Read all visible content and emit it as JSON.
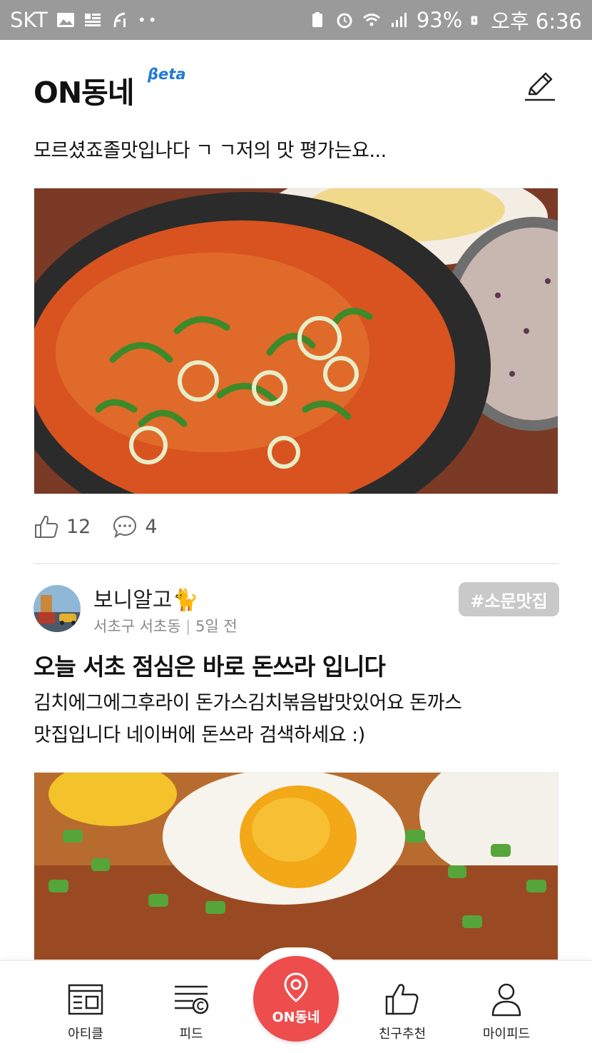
{
  "status_bar": {
    "carrier": "SKT",
    "battery": "93%",
    "time": "오후 6:36"
  },
  "header": {
    "title": "ON동네",
    "badge": "βeta",
    "edit_icon": "pencil-icon"
  },
  "post1": {
    "text": "모르셨죠졸맛입나다 ㄱ ㄱ저의 맛 평가는요...",
    "likes": "12",
    "comments": "4"
  },
  "post2": {
    "author": "보니알고🐈",
    "location": "서초구 서초동",
    "time": "5일 전",
    "tag": "#소문맛집",
    "title": "오늘 서초 점심은 바로 돈쓰라 입니다",
    "body_line1": "김치에그에그후라이 돈가스김치볶음밥맛있어요 돈까스",
    "body_line2": "맛집입니다 네이버에 돈쓰라 검색하세요 :)"
  },
  "nav": {
    "items": [
      {
        "label": "아티클",
        "icon": "article-icon"
      },
      {
        "label": "피드",
        "icon": "feed-icon"
      },
      {
        "label": "ON동네",
        "icon": "location-pin-icon"
      },
      {
        "label": "친구추천",
        "icon": "thumbs-up-icon"
      },
      {
        "label": "마이피드",
        "icon": "person-icon"
      }
    ]
  },
  "colors": {
    "accent": "#ee4d4d",
    "beta": "#1f7ad6",
    "status_bar": "#9a9a9a"
  }
}
